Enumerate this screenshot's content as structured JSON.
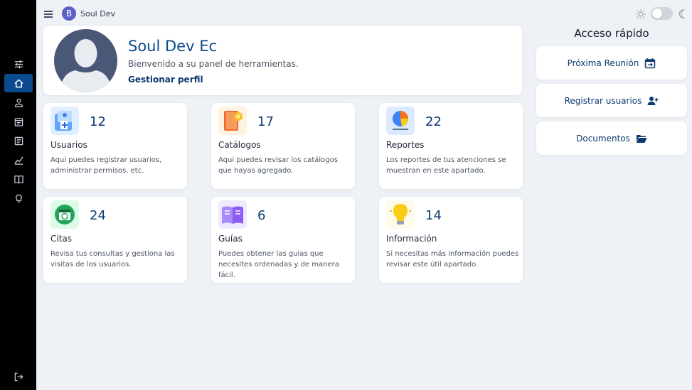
{
  "topbar": {
    "avatar_letter": "B",
    "user_name": "Soul Dev"
  },
  "profile": {
    "name": "Soul Dev Ec",
    "subtitle": "Bienvenido a su panel de herramientas.",
    "manage_link": "Gestionar perfil"
  },
  "tiles": [
    {
      "count": "12",
      "title": "Usuarios",
      "desc": "Aqui puedes registrar usuarios, administrar permisos, etc.",
      "icon": "users-folder-icon",
      "color": "#dbeafe"
    },
    {
      "count": "17",
      "title": "Catálogos",
      "desc": "Aqui puedes revisar los catálogos que hayas agregado.",
      "icon": "catalog-book-icon",
      "color": "#fde7d3"
    },
    {
      "count": "22",
      "title": "Reportes",
      "desc": "Los reportes de tus atenciones se muestran en este apartado.",
      "icon": "pie-report-icon",
      "color": "#dbeafe"
    },
    {
      "count": "24",
      "title": "Citas",
      "desc": "Revisa tus consultas y gestiona las visitas de los usuarios.",
      "icon": "calendar-clock-icon",
      "color": "#dcfce7"
    },
    {
      "count": "6",
      "title": "Guías",
      "desc": "Puedes obtener las guias que necesites ordenadas y de manera fácil.",
      "icon": "open-book-icon",
      "color": "#ede9fe"
    },
    {
      "count": "14",
      "title": "Información",
      "desc": "Si necesitas más información puedes revisar este útil apartado.",
      "icon": "lightbulb-icon",
      "color": "#fef9c3"
    }
  ],
  "quick_access": {
    "title": "Acceso rápido",
    "buttons": [
      {
        "label": "Próxima Reunión",
        "icon": "calendar-arrow-icon"
      },
      {
        "label": "Registrar usuarios",
        "icon": "user-plus-icon"
      },
      {
        "label": "Documentos",
        "icon": "folder-open-icon"
      }
    ]
  },
  "colors": {
    "accent": "#0b4a8f",
    "sidebar": "#000000",
    "background": "#eef1f5"
  }
}
